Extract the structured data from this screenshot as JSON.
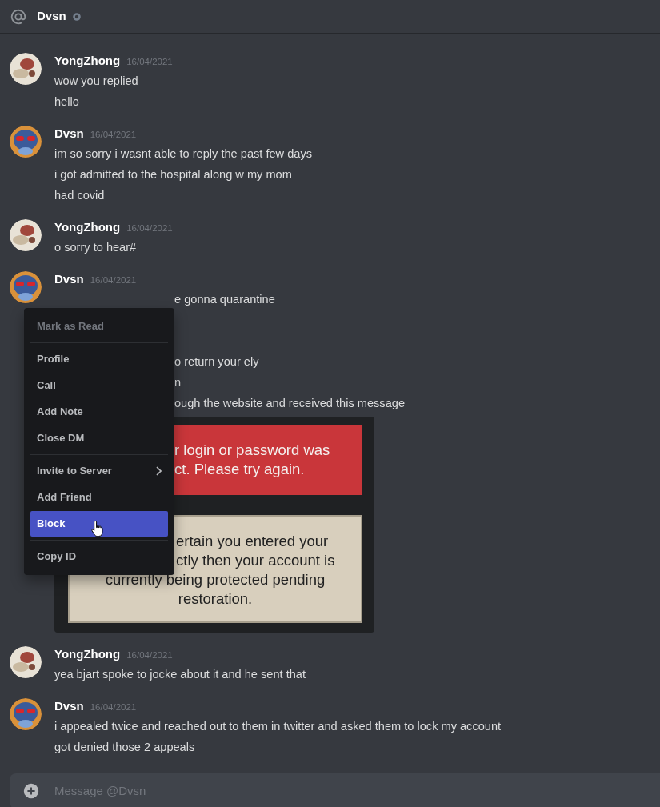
{
  "header": {
    "title": "Dvsn"
  },
  "messages": [
    {
      "author": "YongZhong",
      "date": "16/04/2021",
      "lines": [
        "wow you replied",
        "hello"
      ]
    },
    {
      "author": "Dvsn",
      "date": "16/04/2021",
      "lines": [
        "im so sorry i wasnt able to reply the past few days",
        "i got admitted to the hospital along w my mom",
        "had covid"
      ]
    },
    {
      "author": "YongZhong",
      "date": "16/04/2021",
      "lines": [
        "o sorry to hear#"
      ]
    },
    {
      "author": "Dvsn",
      "date": "16/04/2021",
      "lines_beside_menu": [
        "e gonna quarantine",
        "o return your ely",
        "n",
        "ough the website and received this message"
      ],
      "attachment": {
        "error_lines_beside_menu": [
          "r login or password was",
          "ct. Please try again."
        ],
        "notice_lines_beside_menu": [
          "ertain you entered your",
          "ctly then your account is"
        ],
        "notice_lines": [
          "currently being protected pending",
          "restoration."
        ]
      }
    },
    {
      "author": "YongZhong",
      "date": "16/04/2021",
      "lines": [
        "yea bjart spoke to jocke about it and he sent that"
      ]
    },
    {
      "author": "Dvsn",
      "date": "16/04/2021",
      "lines": [
        "i appealed twice and reached out to them in twitter and asked them to lock my account",
        "got denied those 2 appeals"
      ]
    }
  ],
  "composer": {
    "placeholder": "Message @Dvsn"
  },
  "context_menu": {
    "sections": [
      [
        {
          "label": "Mark as Read",
          "disabled": true,
          "selected": false,
          "submenu": false
        }
      ],
      [
        {
          "label": "Profile",
          "disabled": false,
          "selected": false,
          "submenu": false
        },
        {
          "label": "Call",
          "disabled": false,
          "selected": false,
          "submenu": false
        },
        {
          "label": "Add Note",
          "disabled": false,
          "selected": false,
          "submenu": false
        },
        {
          "label": "Close DM",
          "disabled": false,
          "selected": false,
          "submenu": false
        }
      ],
      [
        {
          "label": "Invite to Server",
          "disabled": false,
          "selected": false,
          "submenu": true
        },
        {
          "label": "Add Friend",
          "disabled": false,
          "selected": false,
          "submenu": false
        },
        {
          "label": "Block",
          "disabled": false,
          "selected": true,
          "submenu": false
        }
      ],
      [
        {
          "label": "Copy ID",
          "disabled": false,
          "selected": false,
          "submenu": false
        }
      ]
    ]
  }
}
